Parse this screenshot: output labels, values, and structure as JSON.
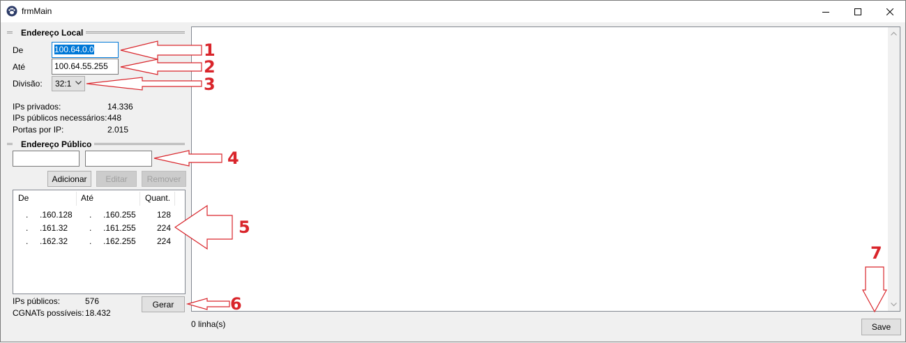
{
  "window": {
    "title": "frmMain",
    "app_icon": "paw-icon",
    "controls": [
      "minimize-icon",
      "maximize-icon",
      "close-icon"
    ]
  },
  "local": {
    "group_title": "Endereço Local",
    "from_label": "De",
    "from_value": "100.64.0.0",
    "to_label": "Até",
    "to_value": "100.64.55.255",
    "division_label": "Divisão:",
    "division_value": "32:1",
    "stats": [
      {
        "label": "IPs privados:",
        "value": "14.336"
      },
      {
        "label": "IPs públicos necessários:",
        "value": "448"
      },
      {
        "label": "Portas por IP:",
        "value": "2.015"
      }
    ]
  },
  "public": {
    "group_title": "Endereço Público",
    "from_value": "",
    "to_value": "",
    "add_button": "Adicionar",
    "edit_button": "Editar",
    "remove_button": "Remover",
    "columns": [
      "De",
      "Até",
      "Quant."
    ],
    "rows": [
      {
        "from_dot": ".",
        "from": ".160.128",
        "to_dot": ".",
        "to": ".160.255",
        "qty": "128"
      },
      {
        "from_dot": ".",
        "from": ".161.32",
        "to_dot": ".",
        "to": ".161.255",
        "qty": "224"
      },
      {
        "from_dot": ".",
        "from": ".162.32",
        "to_dot": ".",
        "to": ".162.255",
        "qty": "224"
      }
    ],
    "public_ips_label": "IPs públicos:",
    "public_ips_value": "576",
    "cgnats_label": "CGNATs possíveis:",
    "cgnats_value": "18.432",
    "generate_button": "Gerar"
  },
  "output": {
    "text": "",
    "status": "0 linha(s)",
    "save_button": "Save"
  },
  "annotations": [
    "1",
    "2",
    "3",
    "4",
    "5",
    "6",
    "7"
  ],
  "colors": {
    "annotation": "#d9252b",
    "accent": "#0078d7",
    "window_bg": "#f0f0f0"
  }
}
